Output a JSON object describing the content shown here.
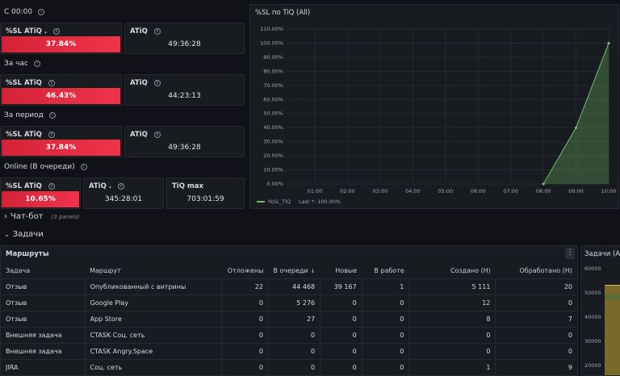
{
  "sections": {
    "since_midnight": "С 00:00",
    "per_hour": "За час",
    "per_period": "За период",
    "online": "Online (В очереди)"
  },
  "stats": {
    "s1": {
      "sl_title": "%SL ATiQ .",
      "sl_value": "37.84%",
      "atiq_title": "ATiQ",
      "atiq_value": "49:36:28"
    },
    "s2": {
      "sl_title": "%SL ATiQ",
      "sl_value": "46.43%",
      "atiq_title": "ATiQ",
      "atiq_value": "44:23:13"
    },
    "s3": {
      "sl_title": "%SL ATiQ",
      "sl_value": "37.84%",
      "atiq_title": "ATiQ",
      "atiq_value": "49:36:28"
    },
    "s4": {
      "sl_title": "%SL ATiQ",
      "sl_value": "10.65%",
      "atiq_title": "ATiQ .",
      "atiq_value": "345:28:01",
      "tiqmax_title": "TiQ max",
      "tiqmax_value": "703:01:59"
    }
  },
  "colors": {
    "red": "#e8283f",
    "series_green": "#73bf69",
    "bg": "#111217",
    "panel": "#181b1f"
  },
  "chart_panel_title": "%SL по TiQ (All)",
  "chart_data": {
    "type": "area",
    "x": [
      "08:00",
      "09:00",
      "10:00"
    ],
    "series": [
      {
        "name": "%SL_TIQ",
        "values": [
          0,
          40,
          100
        ]
      }
    ],
    "x_ticks": [
      "01:00",
      "02:00",
      "03:00",
      "04:00",
      "05:00",
      "06:00",
      "07:00",
      "08:00",
      "09:00",
      "10:00"
    ],
    "y_ticks": [
      "0.00%",
      "10.00%",
      "20.00%",
      "30.00%",
      "40.00%",
      "50.00%",
      "60.00%",
      "70.00%",
      "80.00%",
      "90.00%",
      "100.00%",
      "110.00%"
    ],
    "ylim": [
      0,
      110
    ],
    "grid": true,
    "legend": "bottom-left",
    "legend_text": "Last *: 100.00%"
  },
  "rows": {
    "chatbot": {
      "label": "Чат-бот",
      "note": "(3 panels)",
      "icon": "chevron-right-icon"
    },
    "tasks": {
      "label": "Задачи",
      "icon": "chevron-down-icon"
    }
  },
  "routes": {
    "title": "Маршруты",
    "columns": [
      "Задача",
      "Маршрут",
      "Отложены",
      "В очереди",
      "Новые",
      "В работе",
      "Создано (Н)",
      "Обработано (Н)"
    ],
    "sort_icon": "arrow-down-icon",
    "rows": [
      [
        "Отзыв",
        "Опубликованный с витрины",
        "22",
        "44 468",
        "39 167",
        "1",
        "5 111",
        "20"
      ],
      [
        "Отзыв",
        "Google Play",
        "0",
        "5 276",
        "0",
        "0",
        "12",
        "0"
      ],
      [
        "Отзыв",
        "App Store",
        "0",
        "27",
        "0",
        "0",
        "8",
        "7"
      ],
      [
        "Внешняя задача",
        "CTASK Соц. сеть",
        "0",
        "0",
        "0",
        "0",
        "0",
        "0"
      ],
      [
        "Внешняя задача",
        "CTASK Angry.Space",
        "0",
        "0",
        "0",
        "0",
        "0",
        "0"
      ],
      [
        "JIRA",
        "Соц. сеть",
        "0",
        "0",
        "0",
        "0",
        "1",
        "9"
      ]
    ]
  },
  "tasks_panel": {
    "title": "Задачи (All",
    "y_ticks": [
      "60000",
      "50000",
      "40000",
      "30000",
      "20000"
    ]
  }
}
